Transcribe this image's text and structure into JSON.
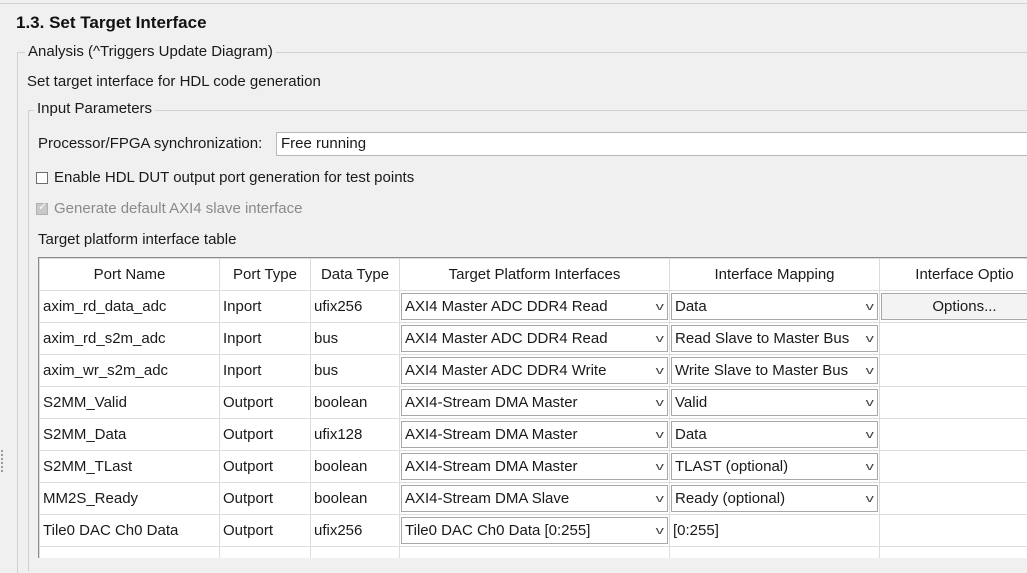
{
  "section": {
    "title": "1.3. Set Target Interface"
  },
  "analysis": {
    "legend": "Analysis (^Triggers Update Diagram)",
    "description": "Set target interface for HDL code generation"
  },
  "input_params": {
    "legend": "Input Parameters",
    "sync_label": "Processor/FPGA synchronization:",
    "sync_value": "Free running",
    "enable_dut_label": "Enable HDL DUT output port generation for test points",
    "gen_axi4_label": "Generate default AXI4 slave interface"
  },
  "table": {
    "title": "Target platform interface table",
    "headers": [
      "Port Name",
      "Port Type",
      "Data Type",
      "Target Platform Interfaces",
      "Interface Mapping",
      "Interface Optio"
    ],
    "rows": [
      {
        "port": "axim_rd_data_adc",
        "type": "Inport",
        "dtype": "ufix256",
        "iface": "AXI4 Master ADC DDR4 Read",
        "mapping": "Data",
        "mapping_select": true,
        "options": "Options..."
      },
      {
        "port": "axim_rd_s2m_adc",
        "type": "Inport",
        "dtype": "bus",
        "iface": "AXI4 Master ADC DDR4 Read",
        "mapping": "Read Slave to Master Bus",
        "mapping_select": true,
        "options": ""
      },
      {
        "port": "axim_wr_s2m_adc",
        "type": "Inport",
        "dtype": "bus",
        "iface": "AXI4 Master ADC DDR4 Write",
        "mapping": "Write Slave to Master Bus",
        "mapping_select": true,
        "options": ""
      },
      {
        "port": "S2MM_Valid",
        "type": "Outport",
        "dtype": "boolean",
        "iface": "AXI4-Stream DMA Master",
        "mapping": "Valid",
        "mapping_select": true,
        "options": ""
      },
      {
        "port": "S2MM_Data",
        "type": "Outport",
        "dtype": "ufix128",
        "iface": "AXI4-Stream DMA Master",
        "mapping": "Data",
        "mapping_select": true,
        "options": ""
      },
      {
        "port": "S2MM_TLast",
        "type": "Outport",
        "dtype": "boolean",
        "iface": "AXI4-Stream DMA Master",
        "mapping": "TLAST (optional)",
        "mapping_select": true,
        "options": ""
      },
      {
        "port": "MM2S_Ready",
        "type": "Outport",
        "dtype": "boolean",
        "iface": "AXI4-Stream DMA Slave",
        "mapping": "Ready (optional)",
        "mapping_select": true,
        "options": ""
      },
      {
        "port": "Tile0 DAC Ch0 Data",
        "type": "Outport",
        "dtype": "ufix256",
        "iface": "Tile0 DAC Ch0 Data [0:255]",
        "mapping": "[0:255]",
        "mapping_select": false,
        "options": ""
      },
      {
        "port": "",
        "type": "",
        "dtype": "",
        "iface": "",
        "mapping": "",
        "mapping_select": false,
        "options": ""
      }
    ]
  }
}
